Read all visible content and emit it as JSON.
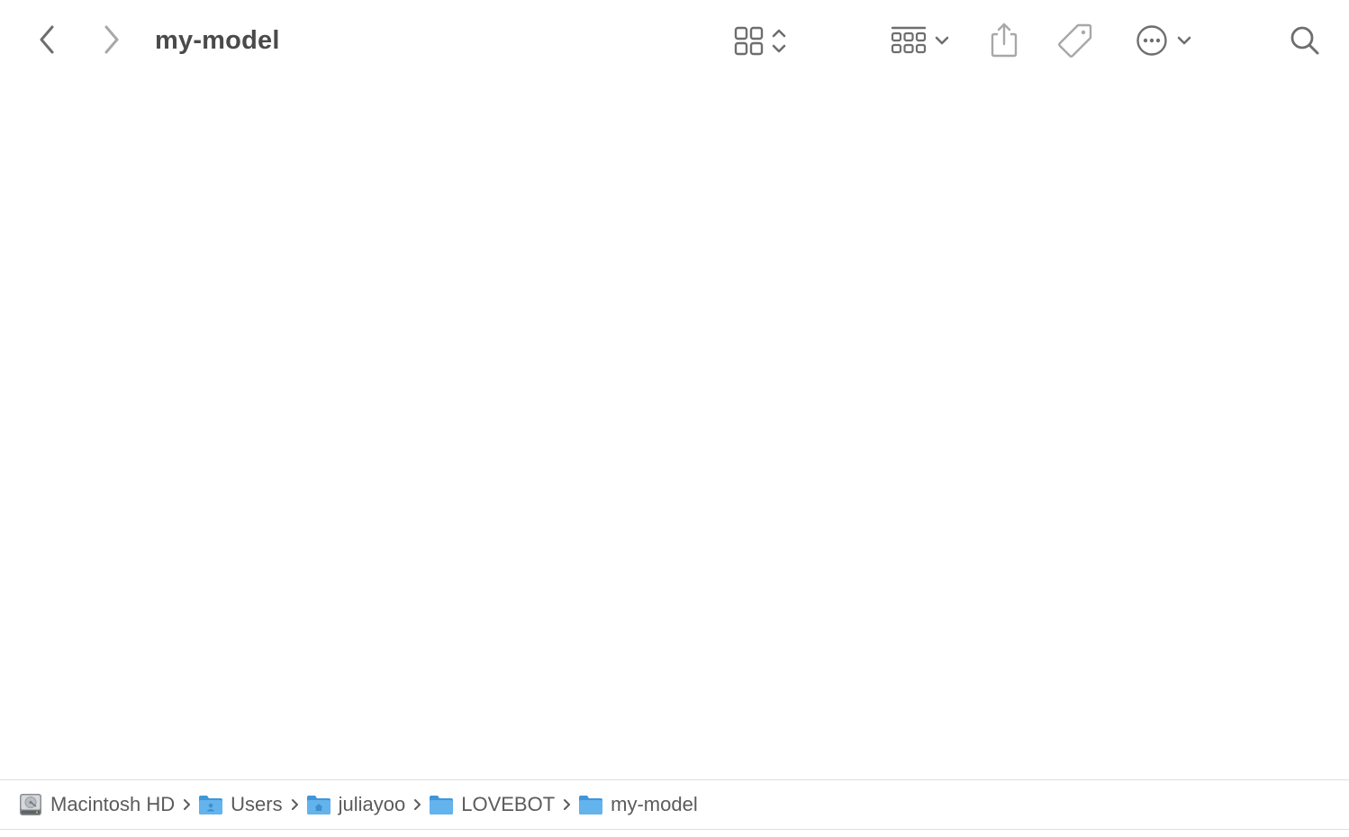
{
  "window": {
    "title": "my-model"
  },
  "toolbar": {
    "back_icon": "chevron-left-icon",
    "forward_icon": "chevron-right-icon",
    "view_icon": "icon-grid-view-icon",
    "group_icon": "group-by-icon",
    "share_icon": "share-icon",
    "tag_icon": "tag-icon",
    "more_icon": "ellipsis-circle-icon",
    "search_icon": "magnifying-glass-icon"
  },
  "pathbar": {
    "items": [
      {
        "label": "Macintosh HD",
        "icon": "hard-drive-icon"
      },
      {
        "label": "Users",
        "icon": "users-folder-icon"
      },
      {
        "label": "juliayoo",
        "icon": "home-folder-icon"
      },
      {
        "label": "LOVEBOT",
        "icon": "folder-icon"
      },
      {
        "label": "my-model",
        "icon": "folder-icon"
      }
    ]
  },
  "colors": {
    "icon_gray": "#6e6e6e",
    "icon_light_gray": "#a8a8a8",
    "title_text": "#4a4a4a",
    "path_text": "#5b5b5b",
    "folder_blue": "#63b3ed",
    "folder_blue_dark": "#3f97d8",
    "divider": "#dedede"
  }
}
